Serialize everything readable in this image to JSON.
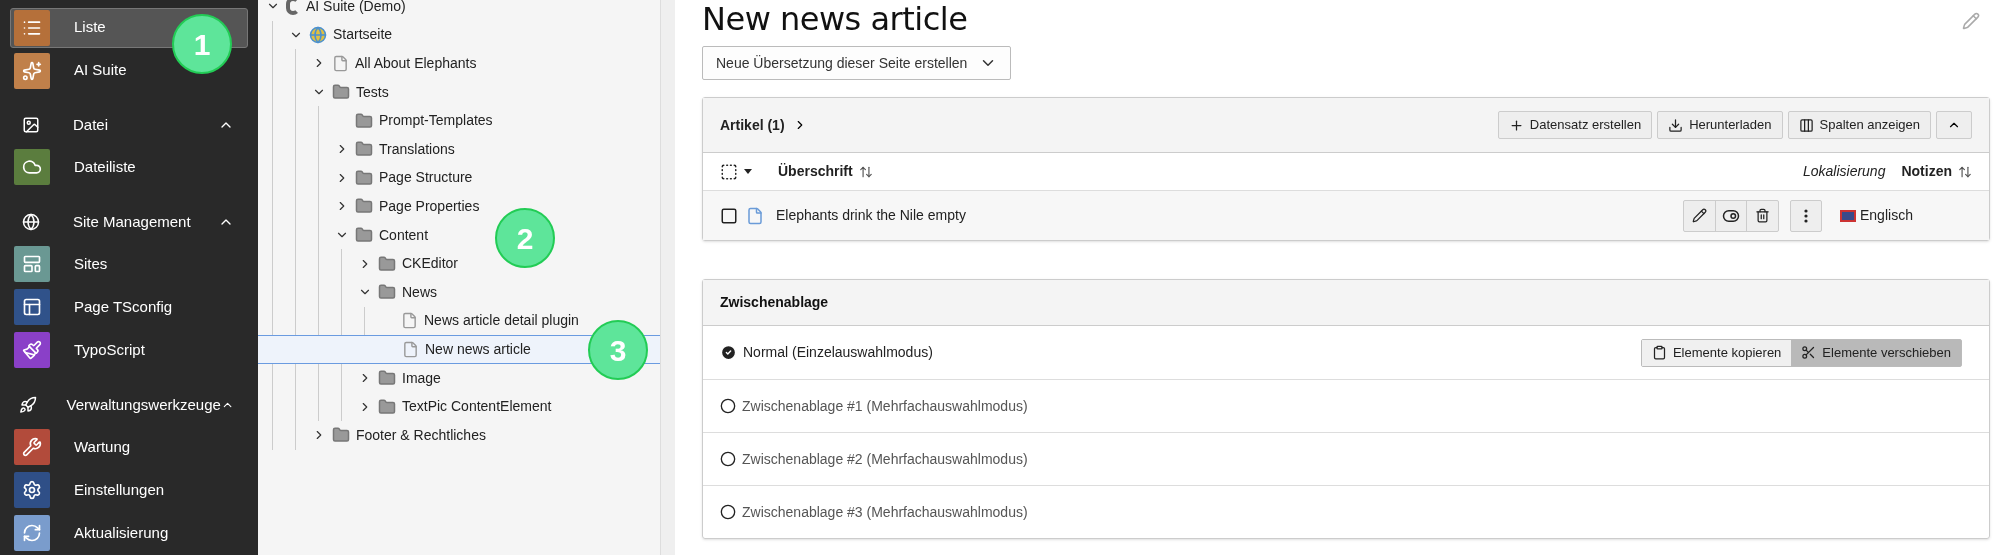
{
  "sidebar": {
    "items": [
      {
        "kind": "module",
        "label": "Liste",
        "color": "#b5703a",
        "selected": true
      },
      {
        "kind": "module",
        "label": "AI Suite",
        "color": "#c0804a",
        "selected": false
      },
      {
        "kind": "group",
        "label": "Datei",
        "expanded": true
      },
      {
        "kind": "module",
        "label": "Dateiliste",
        "color": "#5b7d3e",
        "selected": false
      },
      {
        "kind": "group",
        "label": "Site Management",
        "expanded": true
      },
      {
        "kind": "module",
        "label": "Sites",
        "color": "#6a9893",
        "selected": false
      },
      {
        "kind": "module",
        "label": "Page TSconfig",
        "color": "#30528a",
        "selected": false
      },
      {
        "kind": "module",
        "label": "TypoScript",
        "color": "#8a40c8",
        "selected": false
      },
      {
        "kind": "group",
        "label": "Verwaltungswerkzeuge",
        "expanded": true
      },
      {
        "kind": "module",
        "label": "Wartung",
        "color": "#b24b3b",
        "selected": false
      },
      {
        "kind": "module",
        "label": "Einstellungen",
        "color": "#2f4f87",
        "selected": false
      },
      {
        "kind": "module",
        "label": "Aktualisierung",
        "color": "#7a9ccc",
        "selected": false
      }
    ]
  },
  "page_tree": {
    "nodes": [
      {
        "label": "AI Suite (Demo)",
        "kind": "root",
        "expanded": true,
        "selected": false,
        "children": [
          {
            "label": "Startseite",
            "kind": "site",
            "expanded": true,
            "selected": false,
            "children": [
              {
                "label": "All About Elephants",
                "kind": "page",
                "expanded": false,
                "selected": false
              },
              {
                "label": "Tests",
                "kind": "folder",
                "expanded": true,
                "selected": false,
                "children": [
                  {
                    "label": "Prompt-Templates",
                    "kind": "folder",
                    "selected": false
                  },
                  {
                    "label": "Translations",
                    "kind": "folder",
                    "expanded": false,
                    "selected": false
                  },
                  {
                    "label": "Page Structure",
                    "kind": "folder",
                    "expanded": false,
                    "selected": false
                  },
                  {
                    "label": "Page Properties",
                    "kind": "folder",
                    "expanded": false,
                    "selected": false
                  },
                  {
                    "label": "Content",
                    "kind": "folder",
                    "expanded": true,
                    "selected": false,
                    "children": [
                      {
                        "label": "CKEditor",
                        "kind": "folder",
                        "expanded": false,
                        "selected": false
                      },
                      {
                        "label": "News",
                        "kind": "folder",
                        "expanded": true,
                        "selected": false,
                        "children": [
                          {
                            "label": "News article detail plugin",
                            "kind": "page",
                            "selected": false
                          },
                          {
                            "label": "New news article",
                            "kind": "page",
                            "selected": true
                          }
                        ]
                      },
                      {
                        "label": "Image",
                        "kind": "folder",
                        "expanded": false,
                        "selected": false
                      },
                      {
                        "label": "TextPic ContentElement",
                        "kind": "folder",
                        "expanded": false,
                        "selected": false
                      }
                    ]
                  }
                ]
              },
              {
                "label": "Footer & Rechtliches",
                "kind": "folder",
                "expanded": false,
                "selected": false
              }
            ]
          }
        ]
      }
    ]
  },
  "main": {
    "title": "New news article",
    "translation_select": {
      "value": "Neue Übersetzung dieser Seite erstellen"
    },
    "records_panel": {
      "title": "Artikel (1)",
      "buttons": [
        "Datensatz erstellen",
        "Herunterladen",
        "Spalten anzeigen"
      ],
      "expanded": true,
      "columns": [
        {
          "label": "Überschrift",
          "kind": "sortable"
        },
        {
          "label": "Lokalisierung",
          "kind": "plain"
        },
        {
          "label": "Notizen",
          "kind": "sortable"
        }
      ],
      "select_all_checked": false,
      "rows": [
        {
          "checked": false,
          "title": "Elephants drink the Nile empty",
          "language": "Englisch"
        }
      ]
    },
    "clipboard": {
      "title": "Zwischenablage",
      "modes": [
        {
          "label": "Normal (Einzelauswahlmodus)",
          "selected": true
        },
        {
          "label": "Zwischenablage #1 (Mehrfachauswahlmodus)",
          "selected": false
        },
        {
          "label": "Zwischenablage #2 (Mehrfachauswahlmodus)",
          "selected": false
        },
        {
          "label": "Zwischenablage #3 (Mehrfachauswahlmodus)",
          "selected": false
        }
      ],
      "actions": [
        {
          "label": "Elemente kopieren",
          "selected": false
        },
        {
          "label": "Elemente verschieben",
          "selected": true
        }
      ]
    }
  },
  "markers": [
    {
      "number": "1"
    },
    {
      "number": "2"
    },
    {
      "number": "3"
    }
  ]
}
